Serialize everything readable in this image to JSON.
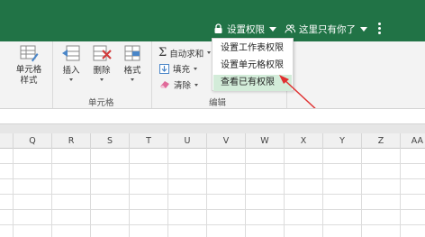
{
  "topbar": {
    "permissions_label": "设置权限",
    "user_label": "这里只有你了",
    "icons": [
      "lock-icon",
      "users-icon",
      "more-vertical-icon"
    ],
    "color": "#217346"
  },
  "ribbon": {
    "cell_style_label": "单元格\n样式",
    "insert_label": "插入",
    "delete_label": "删除",
    "format_label": "格式",
    "cells_group_label": "单元格",
    "autosum_label": "自动求和",
    "fill_label": "填充",
    "clear_label": "清除",
    "edit_group_label": "编辑"
  },
  "dropdown": {
    "items": [
      "设置工作表权限",
      "设置单元格权限",
      "查看已有权限"
    ],
    "active_index": 2
  },
  "columns": [
    "Q",
    "R",
    "S",
    "T",
    "U",
    "V",
    "W",
    "X",
    "Y",
    "Z",
    "AA"
  ],
  "colors": {
    "accent": "#217346",
    "highlight": "#d3ecd9",
    "arrow": "#e03030"
  }
}
